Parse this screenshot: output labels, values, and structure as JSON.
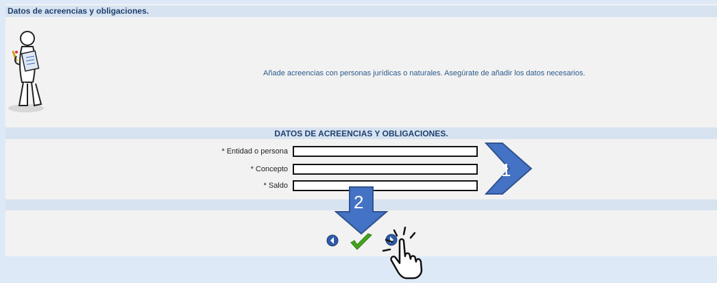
{
  "header": {
    "title": "Datos de acreencias y obligaciones."
  },
  "intro": {
    "description": "Añade acreencias con personas jurídicas o naturales. Asegúrate de añadir los datos necesarios."
  },
  "form": {
    "section_title": "DATOS DE ACREENCIAS Y OBLIGACIONES.",
    "fields": [
      {
        "label": "* Entidad o persona",
        "value": ""
      },
      {
        "label": "* Concepto",
        "value": ""
      },
      {
        "label": "* Saldo",
        "value": ""
      }
    ]
  },
  "actions": {
    "icons": [
      "back-icon",
      "checkmark-icon",
      "forward-icon"
    ]
  },
  "annotations": {
    "step1": "1",
    "step2": "2"
  },
  "colors": {
    "accent": "#4472c4",
    "title": "#1f3f6f",
    "header_bar": "#d7e3f0",
    "check": "#44a51c"
  }
}
